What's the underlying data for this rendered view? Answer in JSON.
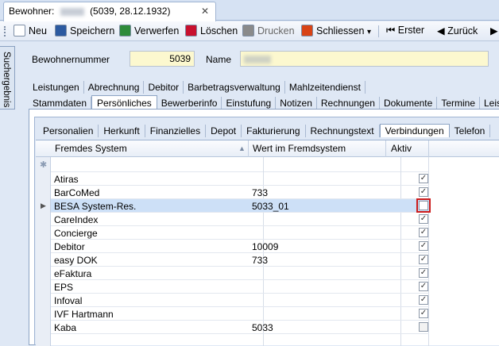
{
  "document_tab": {
    "prefix": "Bewohner:",
    "suffix": "(5039, 28.12.1932)",
    "close": "✕"
  },
  "toolbar": {
    "items": [
      {
        "label": "Neu",
        "icon": "new-doc-icon",
        "color": "#ffffff"
      },
      {
        "label": "Speichern",
        "icon": "save-icon",
        "color": "#2c5aa0"
      },
      {
        "label": "Verwerfen",
        "icon": "discard-icon",
        "color": "#2e8b3a"
      },
      {
        "label": "Löschen",
        "icon": "delete-icon",
        "color": "#c8102e"
      },
      {
        "label": "Drucken",
        "icon": "print-icon",
        "color": "#8a8a8a"
      },
      {
        "label": "Schliessen",
        "icon": "close-icon",
        "color": "#d84315"
      }
    ],
    "nav_first": "Erster",
    "nav_prev": "Zurück"
  },
  "side_tab": {
    "label": "Suchergebnis"
  },
  "header": {
    "number_label": "Bewohnernummer",
    "number_value": "5039",
    "name_label": "Name"
  },
  "tabs_row1": [
    "Leistungen",
    "Abrechnung",
    "Debitor",
    "Barbetragsverwaltung",
    "Mahlzeitendienst"
  ],
  "tabs_row2": [
    "Stammdaten",
    "Persönliches",
    "Bewerberinfo",
    "Einstufung",
    "Notizen",
    "Rechnungen",
    "Dokumente",
    "Termine",
    "Leistu"
  ],
  "tabs_row2_active": "Persönliches",
  "subtabs": [
    "Personalien",
    "Herkunft",
    "Finanzielles",
    "Depot",
    "Fakturierung",
    "Rechnungstext",
    "Verbindungen",
    "Telefon"
  ],
  "subtabs_active": "Verbindungen",
  "grid": {
    "columns": [
      "Fremdes System",
      "Wert im Fremdsystem",
      "Aktiv"
    ],
    "rows": [
      {
        "system": "Atiras",
        "value": "",
        "active": true
      },
      {
        "system": "BarCoMed",
        "value": "733",
        "active": true
      },
      {
        "system": "BESA System-Res.",
        "value": "5033_01",
        "active": false,
        "selected": true
      },
      {
        "system": "CareIndex",
        "value": "",
        "active": true
      },
      {
        "system": "Concierge",
        "value": "",
        "active": true
      },
      {
        "system": "Debitor",
        "value": "10009",
        "active": true
      },
      {
        "system": "easy DOK",
        "value": "733",
        "active": true
      },
      {
        "system": "eFaktura",
        "value": "",
        "active": true
      },
      {
        "system": "EPS",
        "value": "",
        "active": true
      },
      {
        "system": "Infoval",
        "value": "",
        "active": true
      },
      {
        "system": "IVF Hartmann",
        "value": "",
        "active": true
      },
      {
        "system": "Kaba",
        "value": "5033",
        "active": false
      }
    ]
  }
}
